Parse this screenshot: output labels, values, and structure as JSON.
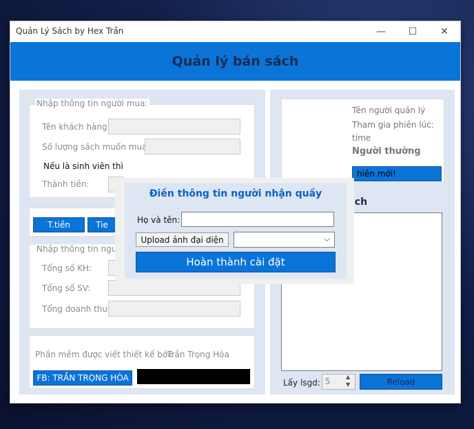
{
  "window": {
    "title": "Quản Lý Sách by Hex Trần",
    "minimize": "—",
    "maximize": "☐",
    "close": "✕"
  },
  "header": {
    "title": "Quản lý bán sách"
  },
  "buyer": {
    "legend": "Nhập thông tin người mua:",
    "customer_label": "Tên khách hàng:",
    "quantity_label": "Số lượng sách muốn mua:",
    "student_label": "Nếu là sinh viên thì",
    "total_label": "Thành tiền:"
  },
  "actions": {
    "calc_button": "T.tiền",
    "second_button": "Tie"
  },
  "stats": {
    "legend": "Nhập thông tin người",
    "total_customers": "Tổng số KH:",
    "total_students": "Tổng số SV:",
    "total_revenue": "Tổng doanh thu:"
  },
  "footer": {
    "author_text": "Phần mềm được viết  thiết kế bởi:",
    "author_name": "Trần Trọng Hòa",
    "fb_button": "FB: TRẦN TRỌNG HÒA"
  },
  "manager": {
    "name_label": "Tên người quản lý",
    "session_label": "Tham gia phiên lúc:",
    "time_label": "time",
    "role": "Người thường",
    "new_session_button": "hiên mới!"
  },
  "history": {
    "title_partial": "ịch",
    "count_label": "Lấy lsgd:",
    "count_value": "5",
    "reload_button": "Reload"
  },
  "dialog": {
    "title": "Điền thông tin người nhận quầy",
    "name_label": "Họ và tên:",
    "name_value": "",
    "upload_button": "Upload ảnh đại diện",
    "select_value": "",
    "finish_button": "Hoàn thành cài đặt"
  },
  "colors": {
    "accent": "#0a74d8",
    "panel": "#dde6f2",
    "title": "#1b2a52"
  }
}
